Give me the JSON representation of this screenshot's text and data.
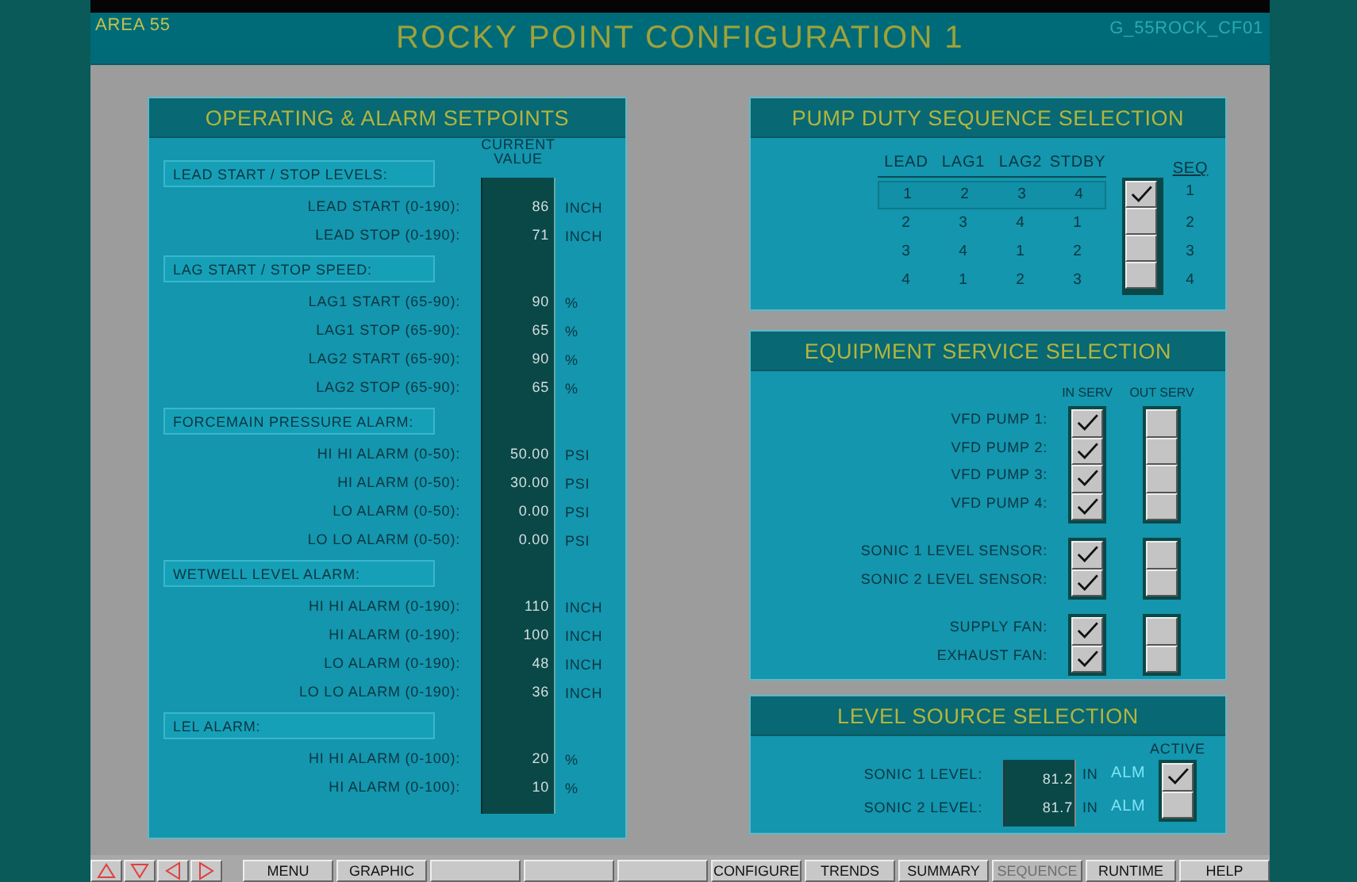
{
  "header": {
    "area": "AREA 55",
    "title": "ROCKY POINT CONFIGURATION 1",
    "screen_id": "G_55ROCK_CF01"
  },
  "setpoints": {
    "title": "OPERATING & ALARM SETPOINTS",
    "value_heading": "CURRENT VALUE",
    "groups": [
      {
        "heading": "LEAD START / STOP LEVELS:",
        "rows": [
          {
            "label": "LEAD START (0-190):",
            "value": "86",
            "unit": "INCH"
          },
          {
            "label": "LEAD STOP (0-190):",
            "value": "71",
            "unit": "INCH"
          }
        ]
      },
      {
        "heading": "LAG START / STOP SPEED:",
        "rows": [
          {
            "label": "LAG1 START (65-90):",
            "value": "90",
            "unit": "%"
          },
          {
            "label": "LAG1 STOP (65-90):",
            "value": "65",
            "unit": "%"
          },
          {
            "label": "LAG2 START (65-90):",
            "value": "90",
            "unit": "%"
          },
          {
            "label": "LAG2 STOP (65-90):",
            "value": "65",
            "unit": "%"
          }
        ]
      },
      {
        "heading": "FORCEMAIN PRESSURE ALARM:",
        "rows": [
          {
            "label": "HI HI ALARM (0-50):",
            "value": "50.00",
            "unit": "PSI"
          },
          {
            "label": "HI ALARM (0-50):",
            "value": "30.00",
            "unit": "PSI"
          },
          {
            "label": "LO ALARM (0-50):",
            "value": "0.00",
            "unit": "PSI"
          },
          {
            "label": "LO LO ALARM (0-50):",
            "value": "0.00",
            "unit": "PSI"
          }
        ]
      },
      {
        "heading": "WETWELL LEVEL ALARM:",
        "rows": [
          {
            "label": "HI HI ALARM (0-190):",
            "value": "110",
            "unit": "INCH"
          },
          {
            "label": "HI ALARM (0-190):",
            "value": "100",
            "unit": "INCH"
          },
          {
            "label": "LO ALARM (0-190):",
            "value": "48",
            "unit": "INCH"
          },
          {
            "label": "LO LO ALARM (0-190):",
            "value": "36",
            "unit": "INCH"
          }
        ]
      },
      {
        "heading": "LEL ALARM:",
        "rows": [
          {
            "label": "HI HI ALARM (0-100):",
            "value": "20",
            "unit": "%"
          },
          {
            "label": "HI ALARM (0-100):",
            "value": "10",
            "unit": "%"
          }
        ]
      }
    ]
  },
  "pump_sequence": {
    "title": "PUMP DUTY SEQUENCE SELECTION",
    "columns": [
      "LEAD",
      "LAG1",
      "LAG2",
      "STDBY"
    ],
    "seq_heading": "SEQ",
    "rows": [
      {
        "cells": [
          "1",
          "2",
          "3",
          "4"
        ],
        "seq": "1",
        "selected": true,
        "checked": true
      },
      {
        "cells": [
          "2",
          "3",
          "4",
          "1"
        ],
        "seq": "2",
        "selected": false,
        "checked": false
      },
      {
        "cells": [
          "3",
          "4",
          "1",
          "2"
        ],
        "seq": "3",
        "selected": false,
        "checked": false
      },
      {
        "cells": [
          "4",
          "1",
          "2",
          "3"
        ],
        "seq": "4",
        "selected": false,
        "checked": false
      }
    ]
  },
  "equipment": {
    "title": "EQUIPMENT SERVICE SELECTION",
    "in_heading": "IN SERV",
    "out_heading": "OUT SERV",
    "groups": [
      {
        "items": [
          {
            "label": "VFD PUMP 1:",
            "in_service": true,
            "out_of_service": false
          },
          {
            "label": "VFD PUMP 2:",
            "in_service": true,
            "out_of_service": false
          },
          {
            "label": "VFD PUMP 3:",
            "in_service": true,
            "out_of_service": false
          },
          {
            "label": "VFD PUMP 4:",
            "in_service": true,
            "out_of_service": false
          }
        ]
      },
      {
        "items": [
          {
            "label": "SONIC 1 LEVEL SENSOR:",
            "in_service": true,
            "out_of_service": false
          },
          {
            "label": "SONIC 2 LEVEL SENSOR:",
            "in_service": true,
            "out_of_service": false
          }
        ]
      },
      {
        "items": [
          {
            "label": "SUPPLY FAN:",
            "in_service": true,
            "out_of_service": false
          },
          {
            "label": "EXHAUST FAN:",
            "in_service": true,
            "out_of_service": false
          }
        ]
      }
    ]
  },
  "level_source": {
    "title": "LEVEL SOURCE SELECTION",
    "active_heading": "ACTIVE",
    "rows": [
      {
        "label": "SONIC 1 LEVEL:",
        "value": "81.2",
        "unit": "IN",
        "alarm": "ALM",
        "active": true
      },
      {
        "label": "SONIC 2 LEVEL:",
        "value": "81.7",
        "unit": "IN",
        "alarm": "ALM",
        "active": false
      }
    ]
  },
  "nav_buttons": [
    {
      "kind": "up"
    },
    {
      "kind": "down"
    },
    {
      "kind": "left"
    },
    {
      "kind": "right"
    }
  ],
  "buttons": [
    {
      "kind": "label",
      "label": "MENU",
      "disabled": false
    },
    {
      "kind": "label",
      "label": "GRAPHIC",
      "disabled": false
    },
    {
      "kind": "blank"
    },
    {
      "kind": "blank"
    },
    {
      "kind": "blank"
    },
    {
      "kind": "label",
      "label": "CONFIGURE",
      "disabled": false
    },
    {
      "kind": "label",
      "label": "TRENDS",
      "disabled": false
    },
    {
      "kind": "label",
      "label": "SUMMARY",
      "disabled": false
    },
    {
      "kind": "label",
      "label": "SEQUENCE",
      "disabled": true
    },
    {
      "kind": "label",
      "label": "RUNTIME",
      "disabled": false
    },
    {
      "kind": "label",
      "label": "HELP",
      "disabled": false
    }
  ]
}
